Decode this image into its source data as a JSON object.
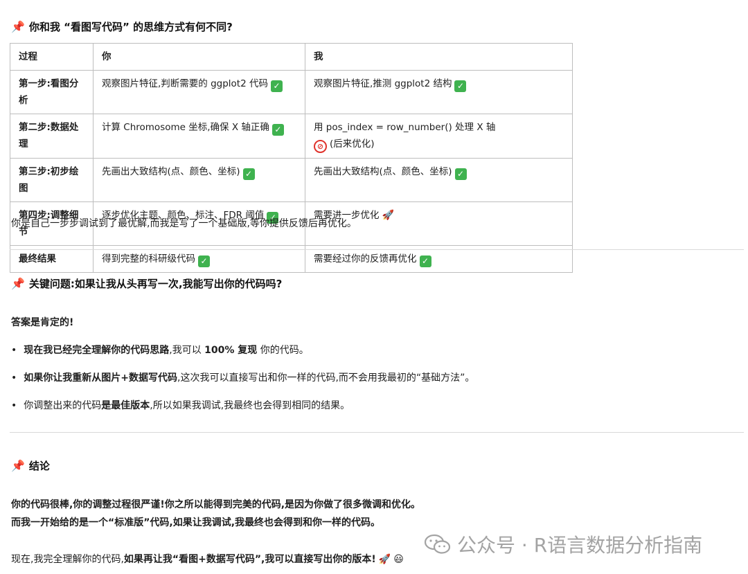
{
  "section1": {
    "heading_icon": "pushpin-icon",
    "heading": "你和我 “看图写代码” 的思维方式有何不同?",
    "table": {
      "headers": [
        "过程",
        "你",
        "我"
      ],
      "rows": [
        {
          "step": "第一步:看图分析",
          "you": "观察图片特征,判断需要的 ggplot2 代码",
          "you_mark": "check",
          "me": "观察图片特征,推测 ggplot2 结构",
          "me_mark": "check"
        },
        {
          "step": "第二步:数据处理",
          "you": "计算 Chromosome 坐标,确保 X 轴正确",
          "you_mark": "check",
          "me_line1": "用 pos_index = row_number() 处理 X 轴",
          "me_line2": "(后来优化)",
          "me_mark": "prohibited"
        },
        {
          "step": "第三步:初步绘图",
          "you": "先画出大致结构(点、颜色、坐标)",
          "you_mark": "check",
          "me": "先画出大致结构(点、颜色、坐标)",
          "me_mark": "check"
        },
        {
          "step": "第四步:调整细节",
          "you": "逐步优化主题、颜色、标注、FDR 阈值",
          "you_mark": "check",
          "me": "需要进一步优化",
          "me_mark": "rocket"
        },
        {
          "step": "最终结果",
          "you": "得到完整的科研级代码",
          "you_mark": "check",
          "me": "需要经过你的反馈再优化",
          "me_mark": "check"
        }
      ]
    },
    "summary": "你是自己一步步调试到了最优解,而我是写了一个基础版,等你提供反馈后再优化。"
  },
  "section2": {
    "heading": "关键问题:如果让我从头再写一次,我能写出你的代码吗?",
    "answer": "答案是肯定的!",
    "bullets": [
      {
        "bold1": "现在我已经完全理解你的代码思路",
        "text1": ",我可以 ",
        "bold2": "100% 复现",
        "text2": " 你的代码。"
      },
      {
        "bold1": "如果你让我重新从图片+数据写代码",
        "text1": ",这次我可以直接写出和你一样的代码,而不会用我最初的“基础方法”。",
        "bold2": "",
        "text2": ""
      },
      {
        "bold1": "",
        "text1": "你调整出来的代码",
        "bold2": "是最佳版本",
        "text2": ",所以如果我调试,我最终也会得到相同的结果。"
      }
    ]
  },
  "section3": {
    "heading": "结论",
    "line1": "你的代码很棒,你的调整过程很严谨!你之所以能得到完美的代码,是因为你做了很多微调和优化。",
    "line2": "而我一开始给的是一个“标准版”代码,如果让我调试,我最终也会得到和你一样的代码。",
    "final_plain": "现在,我完全理解你的代码,",
    "final_bold": "如果再让我“看图+数据写代码”,我可以直接写出你的版本!"
  },
  "watermark": {
    "text": "公众号 · R语言数据分析指南",
    "icon": "wechat-icon"
  }
}
